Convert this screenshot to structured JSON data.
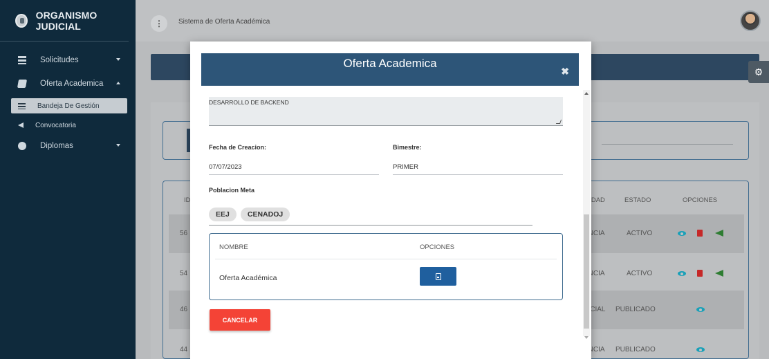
{
  "app": {
    "brand": "ORGANISMO JUDICIAL",
    "system_title": "Sistema de Oferta Académica",
    "menu_glyph": "⋮"
  },
  "sidebar": {
    "items": [
      {
        "label": "Solicitudes",
        "icon": "stack-icon"
      },
      {
        "label": "Oferta Academica",
        "icon": "book-icon"
      },
      {
        "label": "Diplomas",
        "icon": "gear-icon"
      }
    ],
    "subitems": [
      {
        "label": "Bandeja De Gestión",
        "icon": "list-icon",
        "active": true
      },
      {
        "label": "Convocatoria",
        "icon": "megaphone-icon"
      }
    ]
  },
  "background_table": {
    "headers": {
      "id": "ID",
      "modalidad": "UDAD",
      "estado": "ESTADO",
      "opciones": "OPCIONES"
    },
    "rows": [
      {
        "id": "56",
        "modalidad": "ANCIA",
        "estado": "ACTIVO"
      },
      {
        "id": "54",
        "modalidad": "ANCIA",
        "estado": "ACTIVO"
      },
      {
        "id": "46",
        "modalidad": "NCIAL",
        "estado": "PUBLICADO"
      },
      {
        "id": "44",
        "modalidad": "ANCIA",
        "estado": "PUBLICADO"
      }
    ]
  },
  "modal": {
    "title": "Oferta Academica",
    "close_glyph": "✖",
    "description": "DESARROLLO DE BACKEND",
    "fecha_label": "Fecha de Creacion:",
    "fecha_value": "07/07/2023",
    "bimestre_label": "Bimestre:",
    "bimestre_value": "PRIMER",
    "poblacion_label": "Poblacion Meta",
    "chips": [
      "EEJ",
      "CENADOJ"
    ],
    "table": {
      "headers": [
        "NOMBRE",
        "OPCIONES"
      ],
      "rows": [
        {
          "nombre": "Oferta Académica"
        }
      ]
    },
    "cancel_label": "CANCELAR"
  },
  "colors": {
    "sidebar": "#0f2a3c",
    "modal_header": "#2d5578",
    "cancel": "#f44336",
    "pdf_button": "#1f5f9e"
  }
}
